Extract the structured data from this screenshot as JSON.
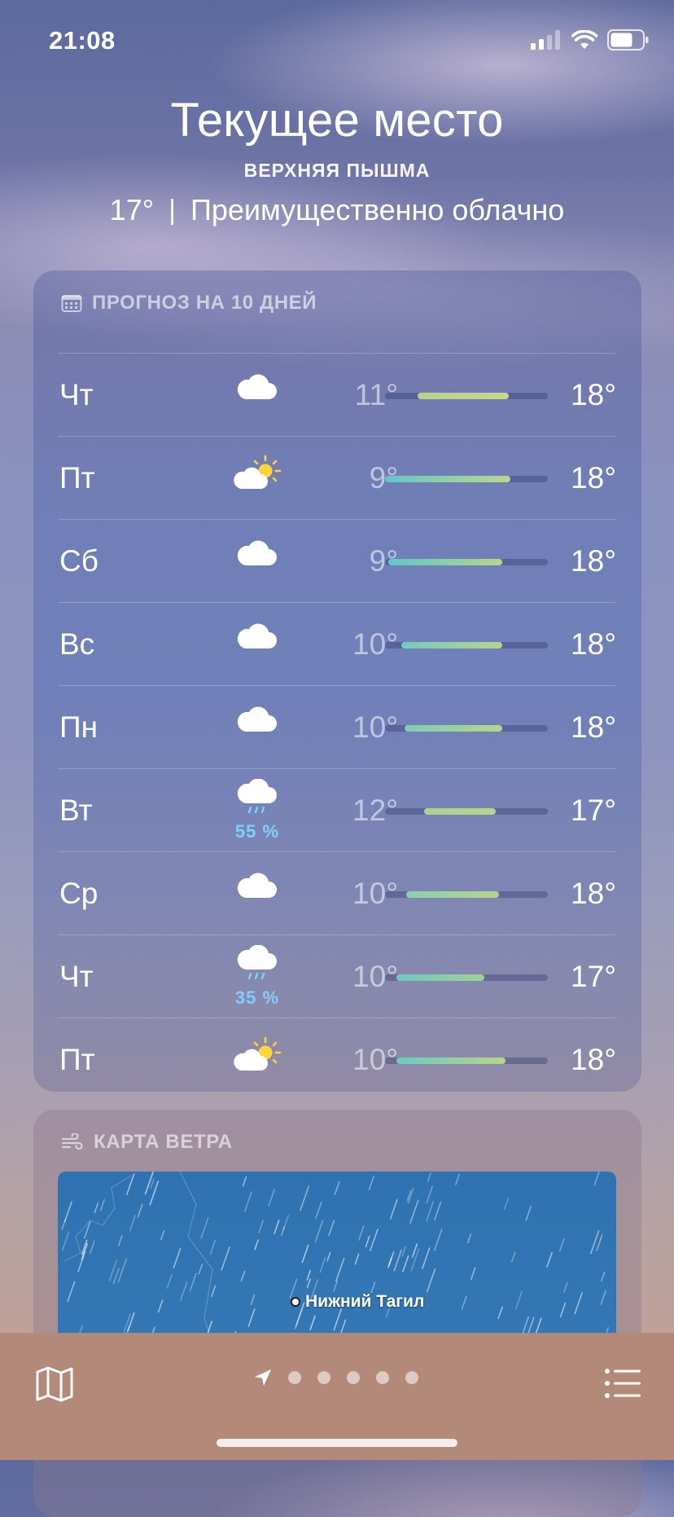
{
  "status_bar": {
    "time": "21:08",
    "icons": [
      "cellular-signal-icon",
      "wifi-icon",
      "battery-icon"
    ]
  },
  "location": {
    "title": "Текущее место",
    "subtitle": "ВЕРХНЯЯ ПЫШМА",
    "temperature": "17°",
    "condition": "Преимущественно облачно"
  },
  "forecast": {
    "header": "ПРОГНОЗ НА 10 ДНЕЙ",
    "header_icon": "calendar-icon",
    "days": [
      {
        "day": "Чт",
        "icon": "cloud-icon",
        "precip": "",
        "low": "11°",
        "high": "18°",
        "range": [
          0.2,
          0.76
        ],
        "colors": [
          "#b8d38a",
          "#c9d68c"
        ]
      },
      {
        "day": "Пт",
        "icon": "partly-sunny-icon",
        "precip": "",
        "low": "9°",
        "high": "18°",
        "range": [
          0.0,
          0.77
        ],
        "colors": [
          "#63c6c8",
          "#bcd68d"
        ]
      },
      {
        "day": "Сб",
        "icon": "cloud-icon",
        "precip": "",
        "low": "9°",
        "high": "18°",
        "range": [
          0.02,
          0.72
        ],
        "colors": [
          "#63c6c8",
          "#b7d48c"
        ]
      },
      {
        "day": "Вс",
        "icon": "cloud-icon",
        "precip": "",
        "low": "10°",
        "high": "18°",
        "range": [
          0.1,
          0.72
        ],
        "colors": [
          "#75c9c0",
          "#b7d48c"
        ]
      },
      {
        "day": "Пн",
        "icon": "cloud-icon",
        "precip": "",
        "low": "10°",
        "high": "18°",
        "range": [
          0.12,
          0.72
        ],
        "colors": [
          "#80ccb8",
          "#b7d48c"
        ]
      },
      {
        "day": "Вт",
        "icon": "rain-cloud-icon",
        "precip": "55 %",
        "low": "12°",
        "high": "17°",
        "range": [
          0.24,
          0.68
        ],
        "colors": [
          "#a9d18f",
          "#b7d48c"
        ]
      },
      {
        "day": "Ср",
        "icon": "cloud-icon",
        "precip": "",
        "low": "10°",
        "high": "18°",
        "range": [
          0.13,
          0.7
        ],
        "colors": [
          "#8acfb2",
          "#b7d48c"
        ]
      },
      {
        "day": "Чт",
        "icon": "rain-cloud-icon",
        "precip": "35 %",
        "low": "10°",
        "high": "17°",
        "range": [
          0.07,
          0.61
        ],
        "colors": [
          "#70c8c2",
          "#9fd099"
        ]
      },
      {
        "day": "Пт",
        "icon": "partly-sunny-icon",
        "precip": "",
        "low": "10°",
        "high": "18°",
        "range": [
          0.07,
          0.74
        ],
        "colors": [
          "#6ec8c4",
          "#b7d48c"
        ]
      }
    ]
  },
  "wind_map": {
    "header": "КАРТА ВЕТРА",
    "header_icon": "wind-icon",
    "city": "Нижний Тагил"
  },
  "toolbar": {
    "map_icon": "map-icon",
    "location_icon": "location-arrow-icon",
    "list_icon": "list-icon",
    "page_dots": 5
  },
  "colors": {
    "precip": "#7fd0ff",
    "sun": "#ffd43a"
  }
}
